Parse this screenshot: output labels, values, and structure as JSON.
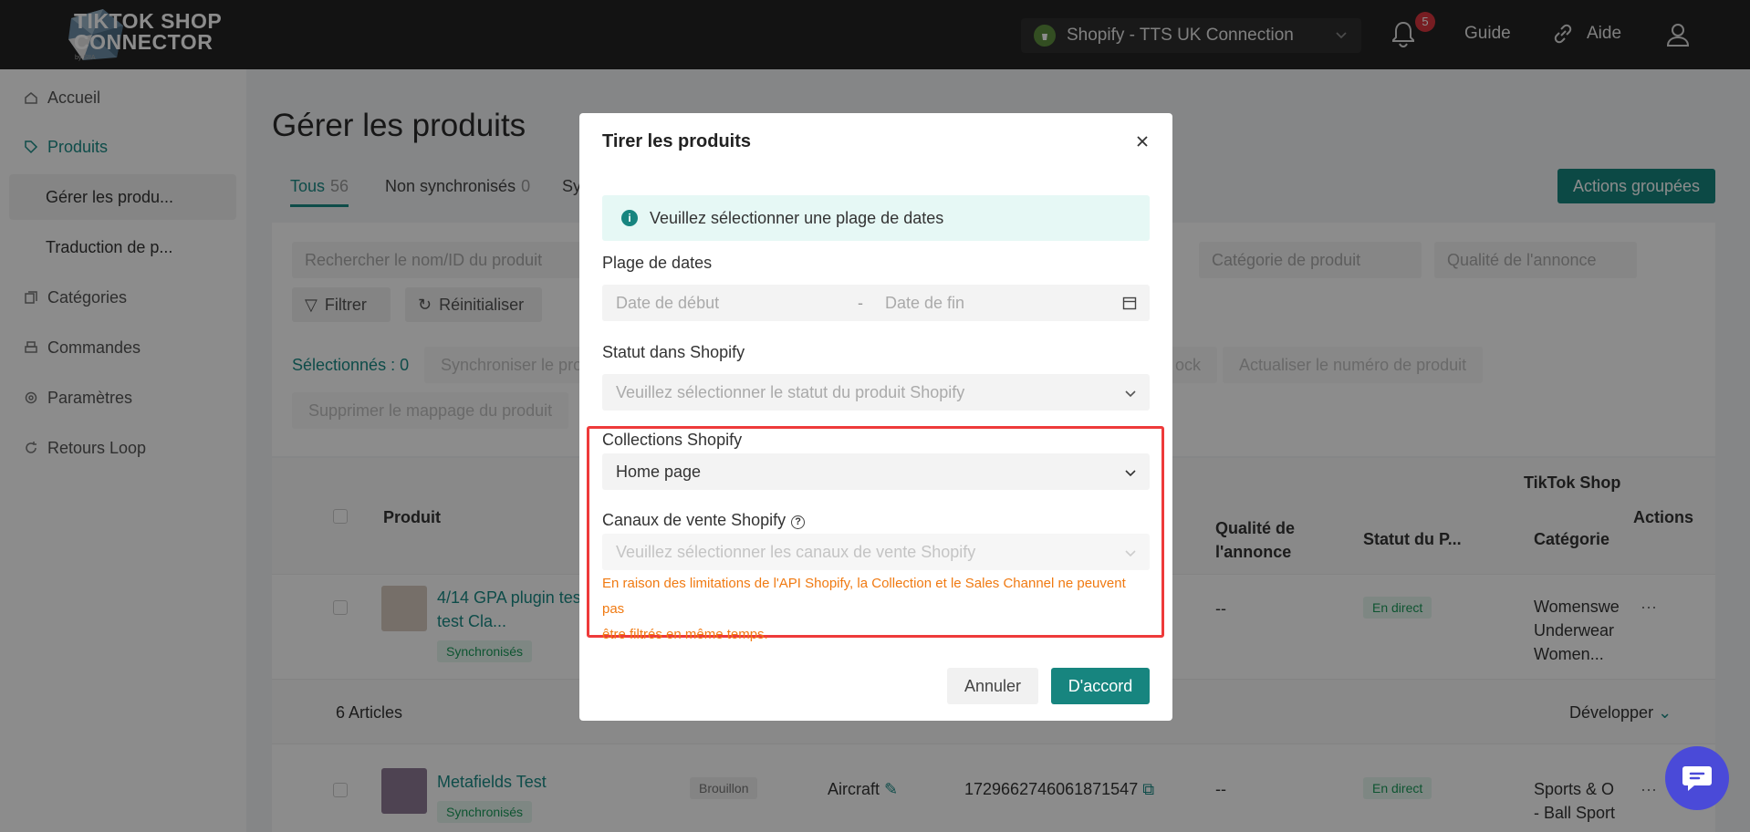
{
  "header": {
    "logo_text_line1": "TIKTOK SHOP",
    "logo_text_line2": "CONNECTOR",
    "logo_by": "by SIIA",
    "store": "Shopify - TTS UK Connection",
    "notification_count": "5",
    "guide": "Guide",
    "help": "Aide"
  },
  "sidebar": {
    "items": [
      {
        "label": "Accueil"
      },
      {
        "label": "Produits"
      },
      {
        "label": "Gérer les produ..."
      },
      {
        "label": "Traduction de p..."
      },
      {
        "label": "Catégories"
      },
      {
        "label": "Commandes"
      },
      {
        "label": "Paramètres"
      },
      {
        "label": "Retours Loop"
      }
    ]
  },
  "main": {
    "title": "Gérer les produits",
    "tabs": [
      {
        "label": "Tous",
        "count": "56"
      },
      {
        "label": "Non synchronisés",
        "count": "0"
      },
      {
        "label": "Sy",
        "count": ""
      }
    ],
    "bulk_actions": "Actions groupées",
    "search_placeholder": "Rechercher le nom/ID du produit",
    "category_filter": "Catégorie de produit",
    "quality_filter": "Qualité de l'annonce",
    "filter_btn": "Filtrer",
    "reset_btn": "Réinitialiser",
    "selected": "Sélectionnés : 0",
    "sync_btn": "Synchroniser le pro",
    "stock_btn": "ock",
    "update_btn": "Actualiser le numéro de produit",
    "delete_mapping_btn": "Supprimer le mappage du produit",
    "table": {
      "tiktok_header": "TikTok Shop",
      "col_product": "Produit",
      "col_quality_1": "Qualité de",
      "col_quality_2": "l'annonce",
      "col_status": "Statut du P...",
      "col_category": "Catégorie",
      "col_actions": "Actions",
      "row1": {
        "name_1": "4/14 GPA plugin test",
        "name_2": "test Cla...",
        "tag": "Synchronisés",
        "quality": "--",
        "status": "En direct",
        "category_1": "Womenswe",
        "category_2": "Underwear",
        "category_3": "Women..."
      },
      "articles": "6 Articles",
      "expand": "Développer",
      "row2": {
        "name": "Metafields Test",
        "tag": "Synchronisés",
        "draft": "Brouillon",
        "brand": "Aircraft",
        "id": "1729662746061871547",
        "quality": "--",
        "status": "En direct",
        "category_1": "Sports & O",
        "category_2": "- Ball Sport"
      }
    }
  },
  "modal": {
    "title": "Tirer les produits",
    "info": "Veuillez sélectionner une plage de dates",
    "date_label": "Plage de dates",
    "date_start": "Date de début",
    "date_sep": "-",
    "date_end": "Date de fin",
    "status_label": "Statut dans Shopify",
    "status_placeholder": "Veuillez sélectionner le statut du produit Shopify",
    "collections_label": "Collections Shopify",
    "collections_value": "Home page",
    "channels_label": "Canaux de vente Shopify",
    "channels_placeholder": "Veuillez sélectionner les canaux de vente Shopify",
    "warning_line1": "En raison des limitations de l'API Shopify, la Collection et le Sales Channel ne peuvent pas",
    "warning_line2": "être filtrés en même temps.",
    "cancel": "Annuler",
    "ok": "D'accord"
  },
  "colors": {
    "accent": "#17857f",
    "warning": "#f07a12",
    "highlight_box": "#ee3a3a",
    "header_bg": "#232323"
  }
}
